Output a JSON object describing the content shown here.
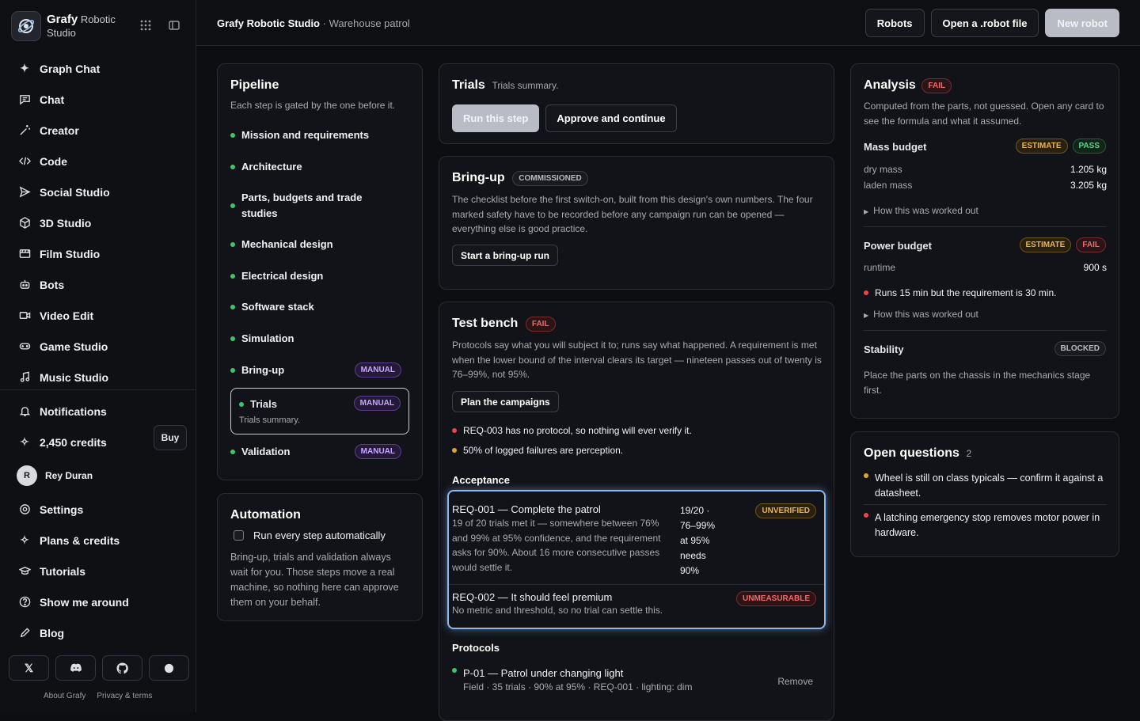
{
  "brand": {
    "name": "Grafy",
    "sub": "Robotic Studio"
  },
  "nav": [
    {
      "label": "Graph Chat",
      "icon": "sparkle-icon"
    },
    {
      "label": "Chat",
      "icon": "chat-icon"
    },
    {
      "label": "Creator",
      "icon": "wand-icon"
    },
    {
      "label": "Code",
      "icon": "code-icon"
    },
    {
      "label": "Social Studio",
      "icon": "send-icon"
    },
    {
      "label": "3D Studio",
      "icon": "cube-icon"
    },
    {
      "label": "Film Studio",
      "icon": "film-icon"
    },
    {
      "label": "Bots",
      "icon": "bot-icon"
    },
    {
      "label": "Video Edit",
      "icon": "video-icon"
    },
    {
      "label": "Game Studio",
      "icon": "gamepad-icon"
    },
    {
      "label": "Music Studio",
      "icon": "music-icon"
    }
  ],
  "notifications": "Notifications",
  "credits": "2,450 credits",
  "buy": "Buy",
  "user": {
    "initial": "R",
    "name": "Rey Duran"
  },
  "nav2": [
    {
      "label": "Settings"
    },
    {
      "label": "Plans & credits"
    },
    {
      "label": "Tutorials"
    },
    {
      "label": "Show me around"
    },
    {
      "label": "Blog"
    }
  ],
  "footer": {
    "about": "About Grafy",
    "privacy": "Privacy & terms"
  },
  "crumb": {
    "app": "Grafy Robotic Studio",
    "sep": " · ",
    "project": "Warehouse patrol"
  },
  "top_buttons": {
    "robots": "Robots",
    "open": "Open a .robot file",
    "new": "New robot"
  },
  "pipeline": {
    "title": "Pipeline",
    "sub": "Each step is gated by the one before it.",
    "steps": [
      "Mission and requirements",
      "Architecture",
      "Parts, budgets and trade studies",
      "Mechanical design",
      "Electrical design",
      "Software stack",
      "Simulation",
      "Bring-up",
      "Trials",
      "Validation"
    ],
    "manual": "MANUAL",
    "trial_sub": "Trials summary."
  },
  "automation": {
    "title": "Automation",
    "checkbox": "Run every step automatically",
    "sub": "Bring-up, trials and validation always wait for you. Those steps move a real machine, so nothing here can approve them on your behalf."
  },
  "trials": {
    "title": "Trials",
    "sub": "Trials summary.",
    "run": "Run this step",
    "approve": "Approve and continue"
  },
  "bringup": {
    "title": "Bring-up",
    "badge": "COMMISSIONED",
    "sub": "The checklist before the first switch-on, built from this design's own numbers. The four marked safety have to be recorded before any campaign run can be opened — everything else is good practice.",
    "btn": "Start a bring-up run"
  },
  "testbench": {
    "title": "Test bench",
    "badge": "FAIL",
    "sub": "Protocols say what you will subject it to; runs say what happened. A requirement is met when the lower bound of the interval clears its target — nineteen passes out of twenty is 76–99%, not 95%.",
    "btn": "Plan the campaigns",
    "issues": [
      "REQ-003 has no protocol, so nothing will ever verify it.",
      "50% of logged failures are perception."
    ],
    "acceptance": "Acceptance",
    "req1": {
      "title": "REQ-001 — Complete the patrol",
      "desc": "19 of 20 trials met it — somewhere between 76% and 99% at 95% confidence, and the requirement asks for 90%. About 16 more consecutive passes would settle it.",
      "stat": "19/20 · 76–99% at 95% needs 90%",
      "badge": "UNVERIFIED"
    },
    "req2": {
      "title": "REQ-002 — It should feel premium",
      "desc": "No metric and threshold, so no trial can settle this.",
      "badge": "UNMEASURABLE"
    },
    "protocols": "Protocols",
    "p1": {
      "title": "P-01 — Patrol under changing light",
      "desc": "Field · 35 trials · 90% at 95% · REQ-001 · lighting: dim",
      "remove": "Remove"
    }
  },
  "analysis": {
    "title": "Analysis",
    "badge": "FAIL",
    "sub": "Computed from the parts, not guessed. Open any card to see the formula and what it assumed.",
    "mass": {
      "title": "Mass budget",
      "b1": "ESTIMATE",
      "b2": "PASS",
      "r1l": "dry mass",
      "r1v": "1.205 kg",
      "r2l": "laden mass",
      "r2v": "3.205 kg",
      "how": "How this was worked out"
    },
    "power": {
      "title": "Power budget",
      "b1": "ESTIMATE",
      "b2": "FAIL",
      "r1l": "runtime",
      "r1v": "900 s",
      "issue": "Runs 15 min but the requirement is 30 min.",
      "how": "How this was worked out"
    },
    "stability": {
      "title": "Stability",
      "badge": "BLOCKED",
      "sub": "Place the parts on the chassis in the mechanics stage first."
    }
  },
  "questions": {
    "title": "Open questions",
    "count": "2",
    "items": [
      "Wheel is still on class typicals — confirm it against a datasheet.",
      "A latching emergency stop removes motor power in hardware."
    ]
  }
}
